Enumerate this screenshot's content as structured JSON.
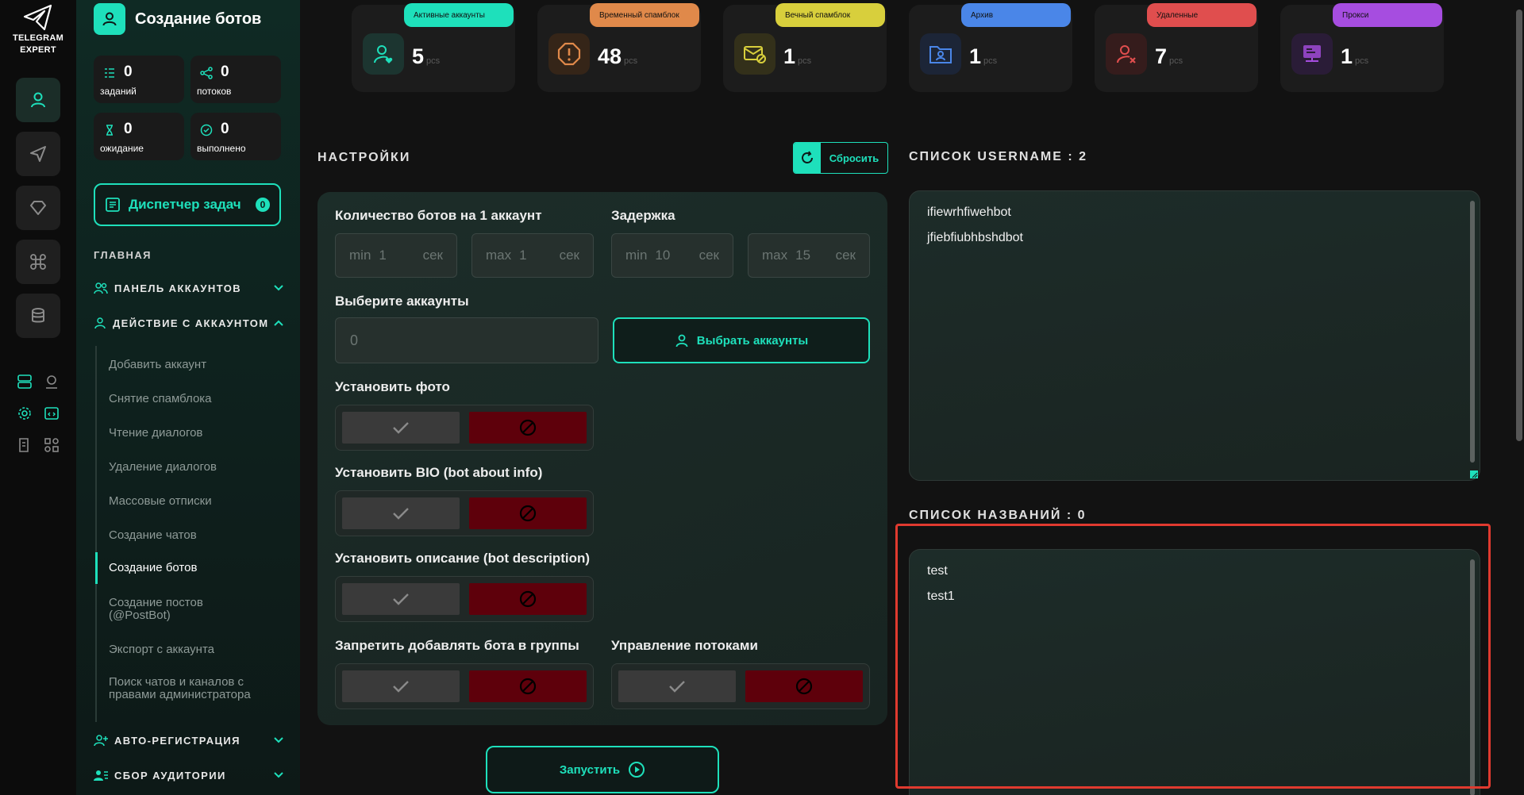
{
  "app": {
    "logo_line1": "TELEGRAM",
    "logo_line2": "EXPERT"
  },
  "page": {
    "title": "Создание ботов"
  },
  "sidebar_stats": [
    {
      "value": "0",
      "label": "заданий",
      "icon": "list-icon"
    },
    {
      "value": "0",
      "label": "потоков",
      "icon": "share-icon"
    },
    {
      "value": "0",
      "label": "ожидание",
      "icon": "hourglass-icon"
    },
    {
      "value": "0",
      "label": "выполнено",
      "icon": "check-circle-icon"
    }
  ],
  "dispatcher": {
    "label": "Диспетчер задач",
    "count": "0"
  },
  "nav": {
    "section_main": "ГЛАВНАЯ",
    "accounts_panel": "ПАНЕЛЬ АККАУНТОВ",
    "account_actions": "ДЕЙСТВИЕ С АККАУНТОМ",
    "sub_items": [
      "Добавить аккаунт",
      "Снятие спамблока",
      "Чтение диалогов",
      "Удаление диалогов",
      "Массовые отписки",
      "Создание чатов",
      "Создание ботов",
      "Создание постов (@PostBot)",
      "Экспорт с аккаунта",
      "Поиск чатов и каналов с правами администратора"
    ],
    "auto_reg": "АВТО-РЕГИСТРАЦИЯ",
    "audience": "СБОР АУДИТОРИИ"
  },
  "top_cards": [
    {
      "tag": "Активные аккаунты",
      "value": "5",
      "unit": "pcs",
      "color": "#1ee0bb",
      "icon": "user-heart-icon"
    },
    {
      "tag": "Временный спамблок",
      "value": "48",
      "unit": "pcs",
      "color": "#e0894a",
      "icon": "warning-icon"
    },
    {
      "tag": "Вечный спамблок",
      "value": "1",
      "unit": "pcs",
      "color": "#d8cf3c",
      "icon": "mail-block-icon"
    },
    {
      "tag": "Архив",
      "value": "1",
      "unit": "pcs",
      "color": "#4a86e8",
      "icon": "folder-user-icon"
    },
    {
      "tag": "Удаленные",
      "value": "7",
      "unit": "pcs",
      "color": "#e04e4e",
      "icon": "user-x-icon"
    },
    {
      "tag": "Прокси",
      "value": "1",
      "unit": "pcs",
      "color": "#a64de0",
      "icon": "proxy-icon"
    }
  ],
  "settings": {
    "title": "НАСТРОЙКИ",
    "reset_label": "Сбросить",
    "bots_per_account_label": "Количество ботов на 1 аккаунт",
    "delay_label": "Задержка",
    "fields": [
      {
        "prefix": "min",
        "value": "1",
        "unit": "сек"
      },
      {
        "prefix": "max",
        "value": "1",
        "unit": "сек"
      },
      {
        "prefix": "min",
        "value": "10",
        "unit": "сек"
      },
      {
        "prefix": "max",
        "value": "15",
        "unit": "сек"
      }
    ],
    "choose_accounts_label": "Выберите аккаунты",
    "accounts_value": "0",
    "choose_accounts_button": "Выбрать аккаунты",
    "set_photo_label": "Установить фото",
    "set_bio_label": "Установить BIO (bot about info)",
    "set_description_label": "Установить описание (bot description)",
    "forbid_groups_label": "Запретить добавлять бота в группы",
    "threads_label": "Управление потоками",
    "launch_label": "Запустить"
  },
  "usernames": {
    "title": "СПИСОК USERNAME : 2",
    "items": [
      "ifiewrhfiwehbot",
      "jfiebfiubhbshdbot"
    ]
  },
  "names": {
    "title": "СПИСОК НАЗВАНИЙ : 0",
    "items": [
      "test",
      "test1"
    ]
  },
  "colors": {
    "accent": "#1ee0bb",
    "off_red": "#5e000b"
  }
}
